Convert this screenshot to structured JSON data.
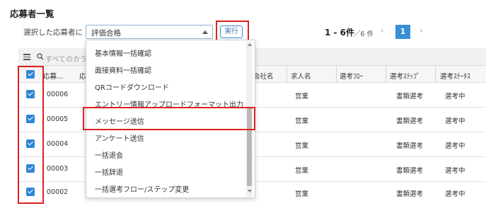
{
  "page": {
    "title": "応募者一覧"
  },
  "action": {
    "label": "選択した応募者に",
    "selected": "評価合格",
    "run_label": "実行",
    "menu": [
      "基本情報一括確認",
      "面接資料一括確認",
      "QRコードダウンロード",
      "エントリー情報アップロードフォーマット出力",
      "メッセージ送信",
      "アンケート送信",
      "一括退会",
      "一括辞退",
      "一括選考フロー/ステップ変更"
    ]
  },
  "pager": {
    "range": "1 - 6件",
    "total": "／6 件",
    "current": "1",
    "prev": "‹",
    "next": "›"
  },
  "search": {
    "placeholder": "すべてのカラ"
  },
  "table": {
    "headers": {
      "id": "応募…",
      "col2": "応",
      "company": "会社名",
      "job": "求人名",
      "flow": "選考ﾌﾛｰ",
      "step": "選考ｽﾃｯﾌﾟ",
      "status": "選考ｽﾃｰﾀｽ"
    },
    "rows": [
      {
        "id": "00006",
        "job": "営業",
        "step": "書類選考",
        "status": "選考中",
        "checked": true
      },
      {
        "id": "00005",
        "job": "営業",
        "step": "書類選考",
        "status": "選考中",
        "checked": true
      },
      {
        "id": "00004",
        "job": "営業",
        "step": "書類選考",
        "status": "選考中",
        "checked": true
      },
      {
        "id": "00003",
        "job": "営業",
        "step": "書類選考",
        "status": "選考中",
        "checked": true
      },
      {
        "id": "00002",
        "job": "営業",
        "step": "書類選考",
        "status": "選考中",
        "checked": true
      }
    ]
  },
  "colors": {
    "accent": "#3a8fd6",
    "highlight": "#e02020"
  }
}
